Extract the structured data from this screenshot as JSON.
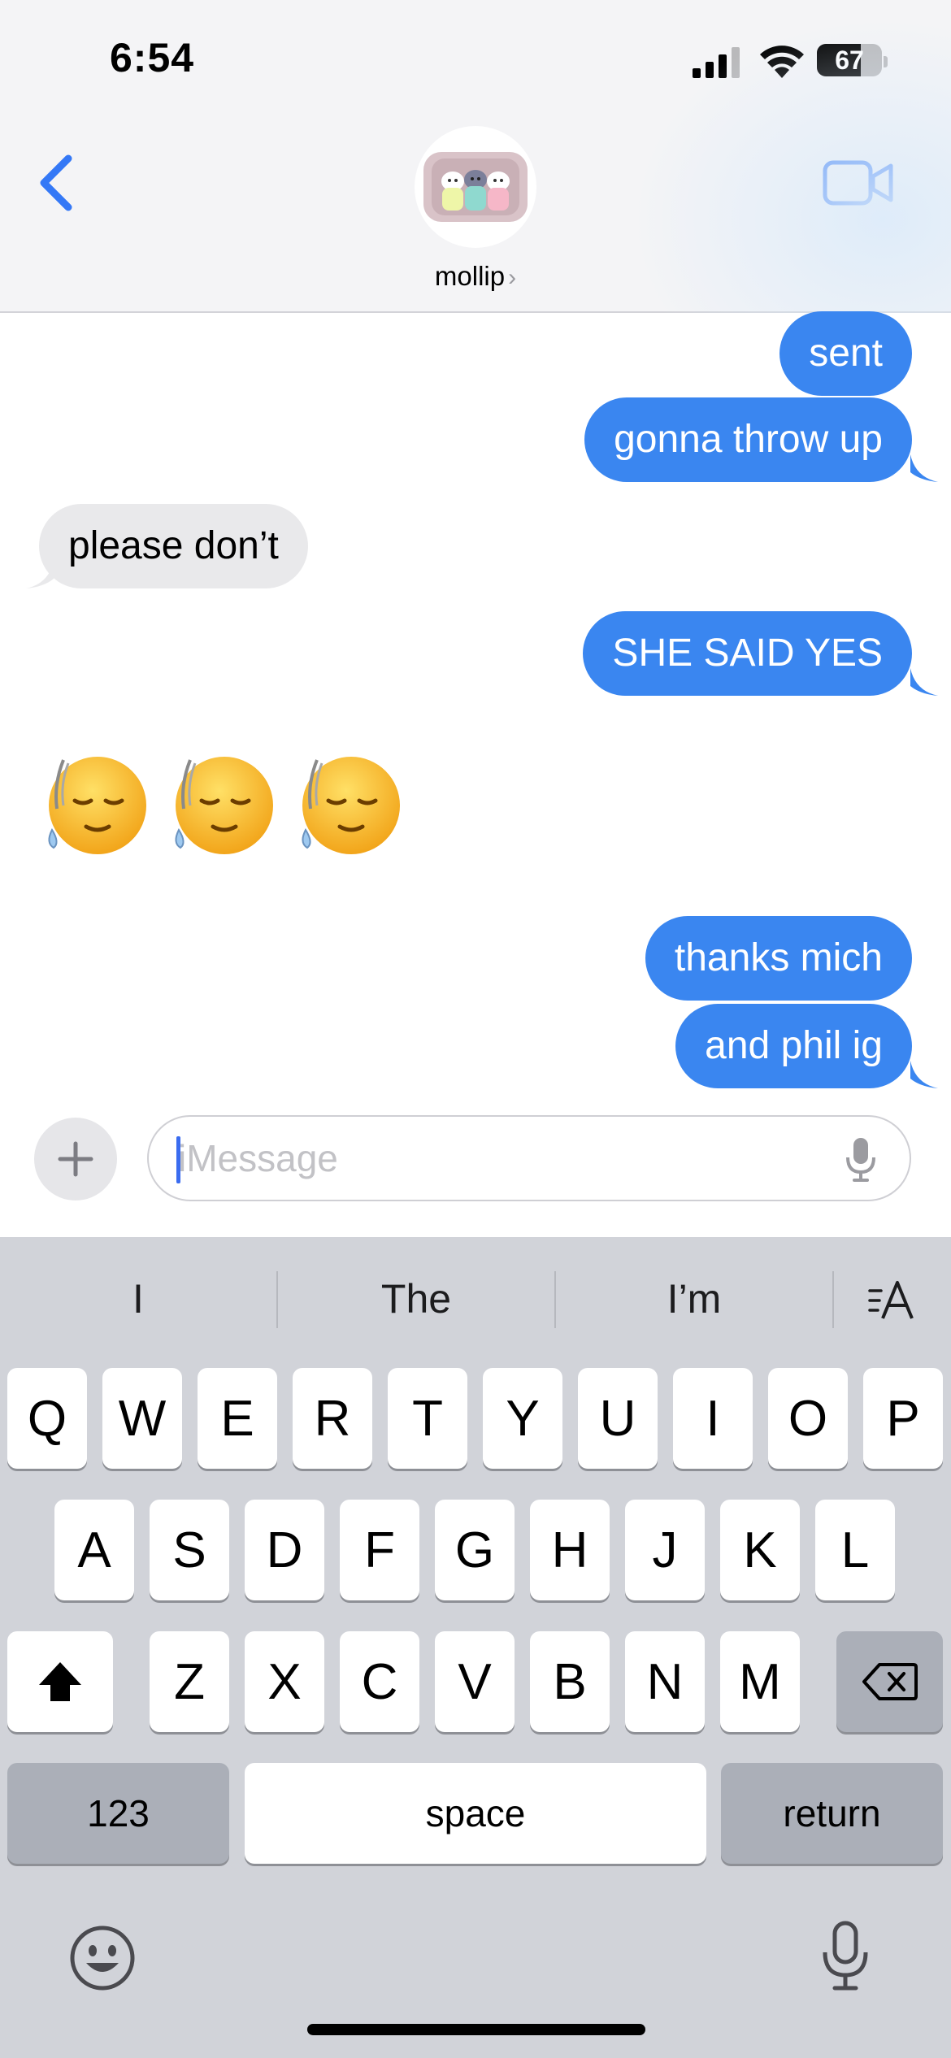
{
  "status_bar": {
    "time": "6:54",
    "battery_level": "67",
    "battery_fraction": 0.67
  },
  "header": {
    "contact_name": "mollip",
    "name_chevron": "›"
  },
  "messages": [
    {
      "direction": "sent",
      "text": "sent"
    },
    {
      "direction": "sent",
      "text": "gonna throw up"
    },
    {
      "direction": "received",
      "text": "please don’t"
    },
    {
      "direction": "sent",
      "text": "SHE SAID YES"
    },
    {
      "direction": "received",
      "emoji": [
        "relieved-face-with-sweat",
        "relieved-face-with-sweat",
        "relieved-face-with-sweat"
      ]
    },
    {
      "direction": "sent",
      "text": "thanks mich"
    },
    {
      "direction": "sent",
      "text": "and phil ig"
    }
  ],
  "compose": {
    "placeholder": "iMessage",
    "value": ""
  },
  "keyboard": {
    "suggestions": [
      "I",
      "The",
      "I’m"
    ],
    "row1": [
      "Q",
      "W",
      "E",
      "R",
      "T",
      "Y",
      "U",
      "I",
      "O",
      "P"
    ],
    "row2": [
      "A",
      "S",
      "D",
      "F",
      "G",
      "H",
      "J",
      "K",
      "L"
    ],
    "row3": [
      "Z",
      "X",
      "C",
      "V",
      "B",
      "N",
      "M"
    ],
    "numbers_key": "123",
    "space_key": "space",
    "return_key": "return"
  },
  "colors": {
    "sent_bubble": "#3a86f0",
    "received_bubble": "#e9e9eb",
    "accent": "#3478f6"
  },
  "icons": [
    "back-chevron-icon",
    "video-camera-icon",
    "plus-icon",
    "microphone-icon",
    "shift-icon",
    "delete-icon",
    "emoji-icon",
    "text-style-icon"
  ]
}
